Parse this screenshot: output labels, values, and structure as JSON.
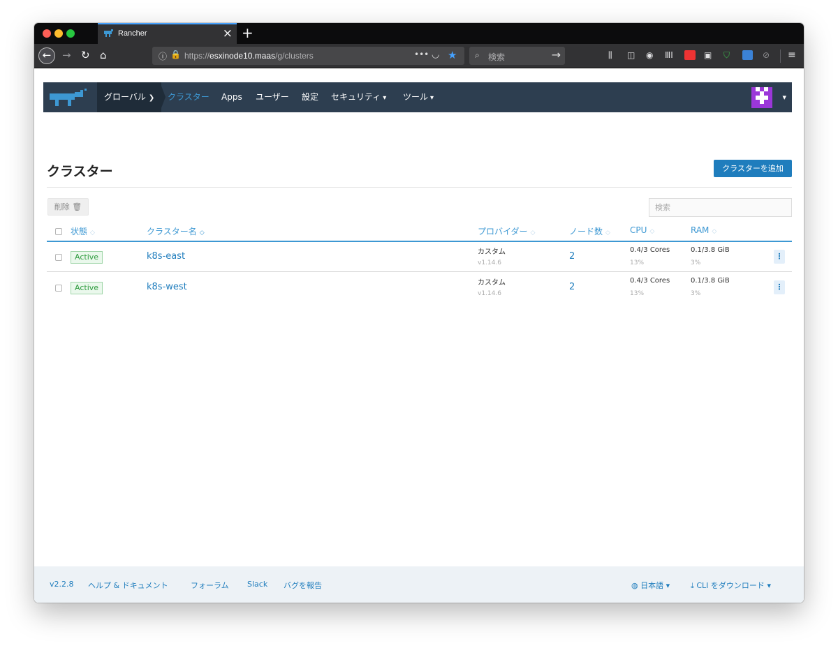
{
  "browser": {
    "tab_title": "Rancher",
    "url_scheme": "https://",
    "url_domain": "esxinode10.maas",
    "url_path": "/g/clusters",
    "search_placeholder": "検索",
    "accent_color": "#45a1ff"
  },
  "app": {
    "nav": {
      "global_label": "グローバル",
      "items": [
        "クラスター",
        "Apps",
        "ユーザー",
        "設定",
        "セキュリティ",
        "ツール"
      ]
    },
    "page_title": "クラスター",
    "add_cluster_label": "クラスターを追加",
    "delete_label": "削除",
    "search_placeholder": "検索",
    "columns": [
      "状態",
      "クラスター名",
      "プロバイダー",
      "ノード数",
      "CPU",
      "RAM"
    ],
    "clusters": [
      {
        "state": "Active",
        "name": "k8s-east",
        "provider": "カスタム",
        "version": "v1.14.6",
        "nodes": "2",
        "cpu": "0.4/3 Cores",
        "cpu_pct": "13%",
        "ram": "0.1/3.8 GiB",
        "ram_pct": "3%"
      },
      {
        "state": "Active",
        "name": "k8s-west",
        "provider": "カスタム",
        "version": "v1.14.6",
        "nodes": "2",
        "cpu": "0.4/3 Cores",
        "cpu_pct": "13%",
        "ram": "0.1/3.8 GiB",
        "ram_pct": "3%"
      }
    ],
    "footer": {
      "version": "v2.2.8",
      "help": "ヘルプ & ドキュメント",
      "forum": "フォーラム",
      "slack": "Slack",
      "report_bug": "バグを報告",
      "language": "日本語",
      "cli_download": "CLI をダウンロード"
    },
    "colors": {
      "header_bg": "#2d3e50",
      "link": "#1f7dbd",
      "active": "#2e9b3e",
      "footer_bg": "#edf2f6"
    }
  }
}
